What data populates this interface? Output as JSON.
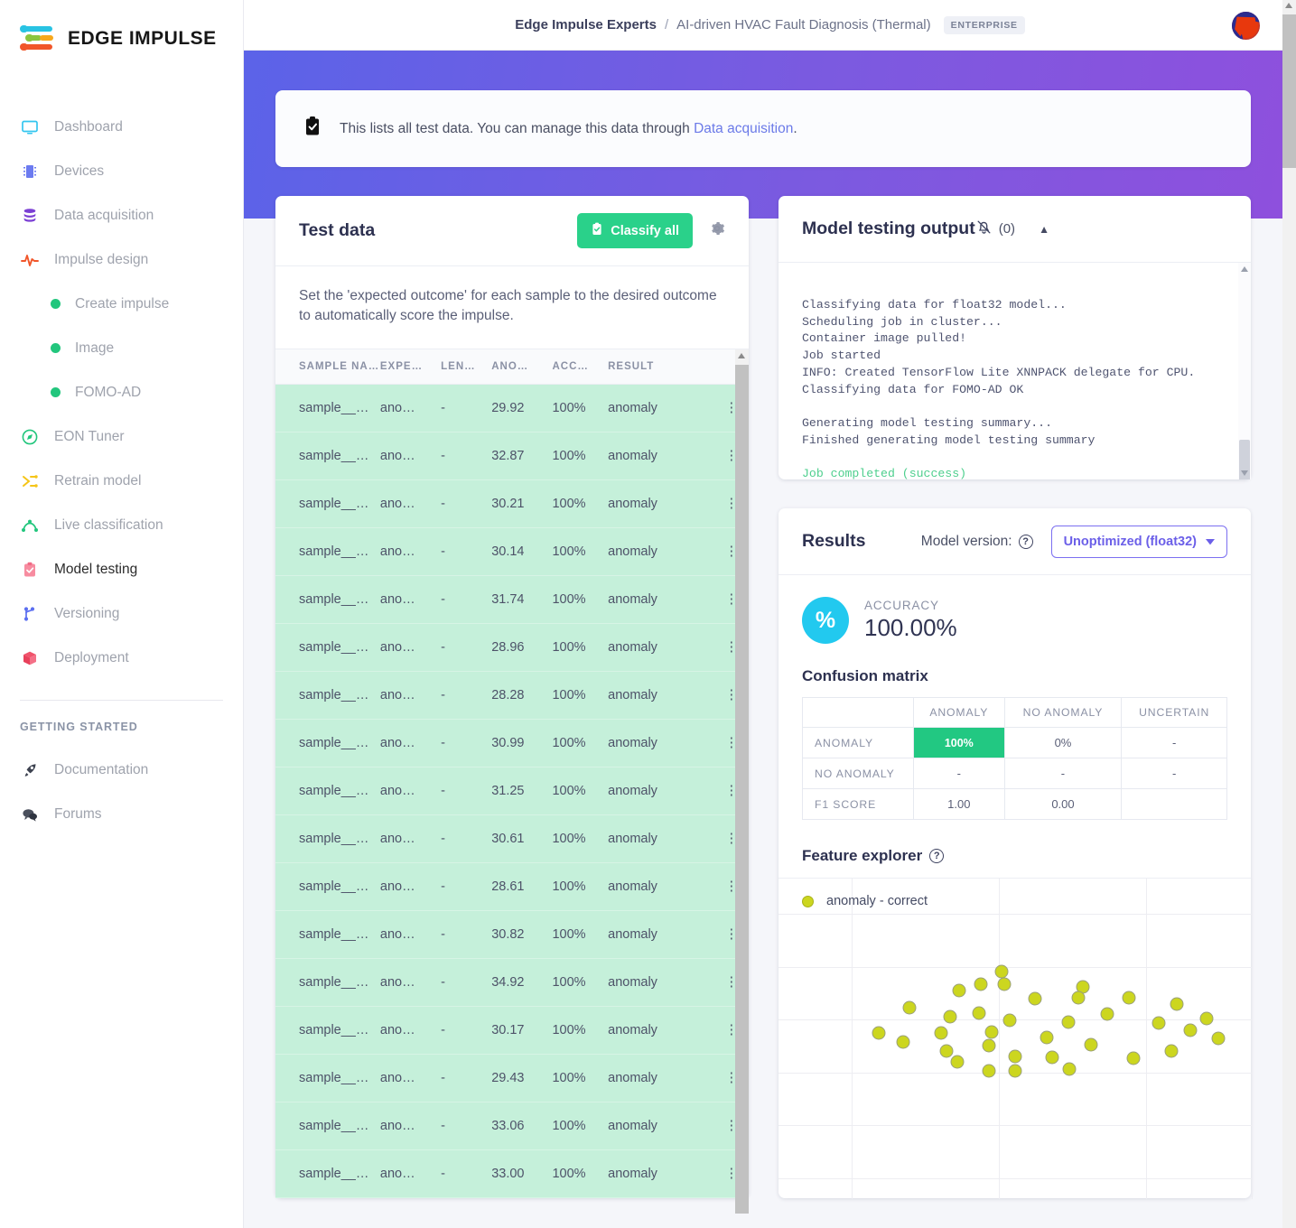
{
  "brand": {
    "name": "EDGE IMPULSE"
  },
  "sidebar": {
    "items": [
      {
        "label": "Dashboard",
        "icon": "monitor-icon"
      },
      {
        "label": "Devices",
        "icon": "chip-icon"
      },
      {
        "label": "Data acquisition",
        "icon": "database-icon"
      },
      {
        "label": "Impulse design",
        "icon": "pulse-icon"
      }
    ],
    "sub_items": [
      {
        "label": "Create impulse"
      },
      {
        "label": "Image"
      },
      {
        "label": "FOMO-AD"
      }
    ],
    "items2": [
      {
        "label": "EON Tuner",
        "icon": "compass-icon"
      },
      {
        "label": "Retrain model",
        "icon": "shuffle-icon"
      },
      {
        "label": "Live classification",
        "icon": "graph-icon"
      },
      {
        "label": "Model testing",
        "icon": "clipboard-check-icon",
        "active": true
      },
      {
        "label": "Versioning",
        "icon": "branch-icon"
      },
      {
        "label": "Deployment",
        "icon": "box-icon"
      }
    ],
    "section_label": "GETTING STARTED",
    "items3": [
      {
        "label": "Documentation",
        "icon": "rocket-icon"
      },
      {
        "label": "Forums",
        "icon": "chat-icon"
      }
    ]
  },
  "topbar": {
    "org": "Edge Impulse Experts",
    "separator": "/",
    "project": "AI-driven HVAC Fault Diagnosis (Thermal)",
    "plan_badge": "ENTERPRISE"
  },
  "notice": {
    "icon": "clipboard-check-icon",
    "text_before": "This lists all test data. You can manage this data through ",
    "link": "Data acquisition",
    "text_after": "."
  },
  "test_data": {
    "title": "Test data",
    "classify_button": "Classify all",
    "gear_icon": "gear-icon",
    "subtitle": "Set the 'expected outcome' for each sample to the desired outcome to automatically score the impulse.",
    "columns": [
      "SAMPLE NA…",
      "EXPE…",
      "LEN…",
      "ANO…",
      "ACC…",
      "RESULT"
    ],
    "rows": [
      {
        "name": "sample__…",
        "expected": "ano…",
        "length": "-",
        "anomaly": "29.92",
        "accuracy": "100%",
        "result": "anomaly"
      },
      {
        "name": "sample__…",
        "expected": "ano…",
        "length": "-",
        "anomaly": "32.87",
        "accuracy": "100%",
        "result": "anomaly"
      },
      {
        "name": "sample__…",
        "expected": "ano…",
        "length": "-",
        "anomaly": "30.21",
        "accuracy": "100%",
        "result": "anomaly"
      },
      {
        "name": "sample__…",
        "expected": "ano…",
        "length": "-",
        "anomaly": "30.14",
        "accuracy": "100%",
        "result": "anomaly"
      },
      {
        "name": "sample__…",
        "expected": "ano…",
        "length": "-",
        "anomaly": "31.74",
        "accuracy": "100%",
        "result": "anomaly"
      },
      {
        "name": "sample__…",
        "expected": "ano…",
        "length": "-",
        "anomaly": "28.96",
        "accuracy": "100%",
        "result": "anomaly"
      },
      {
        "name": "sample__…",
        "expected": "ano…",
        "length": "-",
        "anomaly": "28.28",
        "accuracy": "100%",
        "result": "anomaly"
      },
      {
        "name": "sample__…",
        "expected": "ano…",
        "length": "-",
        "anomaly": "30.99",
        "accuracy": "100%",
        "result": "anomaly"
      },
      {
        "name": "sample__…",
        "expected": "ano…",
        "length": "-",
        "anomaly": "31.25",
        "accuracy": "100%",
        "result": "anomaly"
      },
      {
        "name": "sample__…",
        "expected": "ano…",
        "length": "-",
        "anomaly": "30.61",
        "accuracy": "100%",
        "result": "anomaly"
      },
      {
        "name": "sample__…",
        "expected": "ano…",
        "length": "-",
        "anomaly": "28.61",
        "accuracy": "100%",
        "result": "anomaly"
      },
      {
        "name": "sample__…",
        "expected": "ano…",
        "length": "-",
        "anomaly": "30.82",
        "accuracy": "100%",
        "result": "anomaly"
      },
      {
        "name": "sample__…",
        "expected": "ano…",
        "length": "-",
        "anomaly": "34.92",
        "accuracy": "100%",
        "result": "anomaly"
      },
      {
        "name": "sample__…",
        "expected": "ano…",
        "length": "-",
        "anomaly": "30.17",
        "accuracy": "100%",
        "result": "anomaly"
      },
      {
        "name": "sample__…",
        "expected": "ano…",
        "length": "-",
        "anomaly": "29.43",
        "accuracy": "100%",
        "result": "anomaly"
      },
      {
        "name": "sample__…",
        "expected": "ano…",
        "length": "-",
        "anomaly": "33.06",
        "accuracy": "100%",
        "result": "anomaly"
      },
      {
        "name": "sample__…",
        "expected": "ano…",
        "length": "-",
        "anomaly": "33.00",
        "accuracy": "100%",
        "result": "anomaly"
      }
    ],
    "row_menu_icon": "kebab-menu-icon"
  },
  "model_output": {
    "title": "Model testing output",
    "mute_icon": "bell-muted-icon",
    "count": "(0)",
    "collapse_icon": "caret-up-icon",
    "log_lines": [
      "Classifying data for float32 model...",
      "Scheduling job in cluster...",
      "Container image pulled!",
      "Job started",
      "INFO: Created TensorFlow Lite XNNPACK delegate for CPU.",
      "Classifying data for FOMO-AD OK",
      "",
      "Generating model testing summary...",
      "Finished generating model testing summary",
      ""
    ],
    "success_line": "Job completed (success)"
  },
  "results": {
    "title": "Results",
    "model_version_label": "Model version:",
    "help_icon": "question-icon",
    "version_selected": "Unoptimized (float32)",
    "accuracy_label": "ACCURACY",
    "accuracy_value": "100.00%",
    "accuracy_icon": "percent-icon",
    "confusion_title": "Confusion matrix",
    "feature_explorer_title": "Feature explorer",
    "colors": {
      "accent_green": "#22c882",
      "accent_cyan": "#22c9ef",
      "point": "#ccd61f",
      "purple": "#6b5fe8"
    }
  },
  "chart_data": [
    {
      "type": "table",
      "title": "Confusion matrix",
      "columns": [
        "",
        "ANOMALY",
        "NO ANOMALY",
        "UNCERTAIN"
      ],
      "rows": [
        {
          "header": "ANOMALY",
          "cells": [
            "100%",
            "0%",
            "-"
          ],
          "highlight": [
            true,
            false,
            false
          ]
        },
        {
          "header": "NO ANOMALY",
          "cells": [
            "-",
            "-",
            "-"
          ],
          "highlight": [
            false,
            false,
            false
          ]
        },
        {
          "header": "F1 SCORE",
          "cells": [
            "1.00",
            "0.00",
            ""
          ],
          "highlight": [
            false,
            false,
            false
          ]
        }
      ]
    },
    {
      "type": "scatter",
      "title": "Feature explorer",
      "legend": [
        "anomaly - correct"
      ],
      "legend_position": "top-left",
      "grid": true,
      "xlabel": "",
      "ylabel": "",
      "xlim": [
        0,
        100
      ],
      "ylim": [
        0,
        100
      ],
      "series": [
        {
          "name": "anomaly - correct",
          "color": "#ccd61f",
          "points": [
            [
              46.8,
              79.0
            ],
            [
              42.0,
              73.6
            ],
            [
              47.3,
              73.4
            ],
            [
              37.1,
              70.7
            ],
            [
              54.2,
              67.1
            ],
            [
              65.0,
              72.1
            ],
            [
              64.0,
              67.3
            ],
            [
              75.6,
              67.2
            ],
            [
              86.3,
              64.5
            ],
            [
              26.0,
              63.0
            ],
            [
              35.2,
              58.6
            ],
            [
              41.7,
              60.5
            ],
            [
              70.7,
              60.0
            ],
            [
              93.0,
              58.0
            ],
            [
              48.6,
              57.0
            ],
            [
              61.8,
              56.5
            ],
            [
              82.3,
              56.0
            ],
            [
              19.0,
              51.5
            ],
            [
              33.0,
              51.4
            ],
            [
              44.4,
              51.9
            ],
            [
              89.4,
              52.6
            ],
            [
              57.0,
              49.5
            ],
            [
              95.8,
              48.9
            ],
            [
              24.5,
              47.5
            ],
            [
              43.8,
              45.6
            ],
            [
              67.0,
              46.0
            ],
            [
              85.2,
              43.4
            ],
            [
              34.3,
              43.2
            ],
            [
              49.8,
              40.7
            ],
            [
              58.2,
              40.5
            ],
            [
              76.6,
              39.8
            ],
            [
              36.8,
              38.3
            ],
            [
              43.9,
              34.2
            ],
            [
              49.8,
              34.2
            ],
            [
              62.0,
              35.1
            ]
          ]
        }
      ]
    }
  ]
}
